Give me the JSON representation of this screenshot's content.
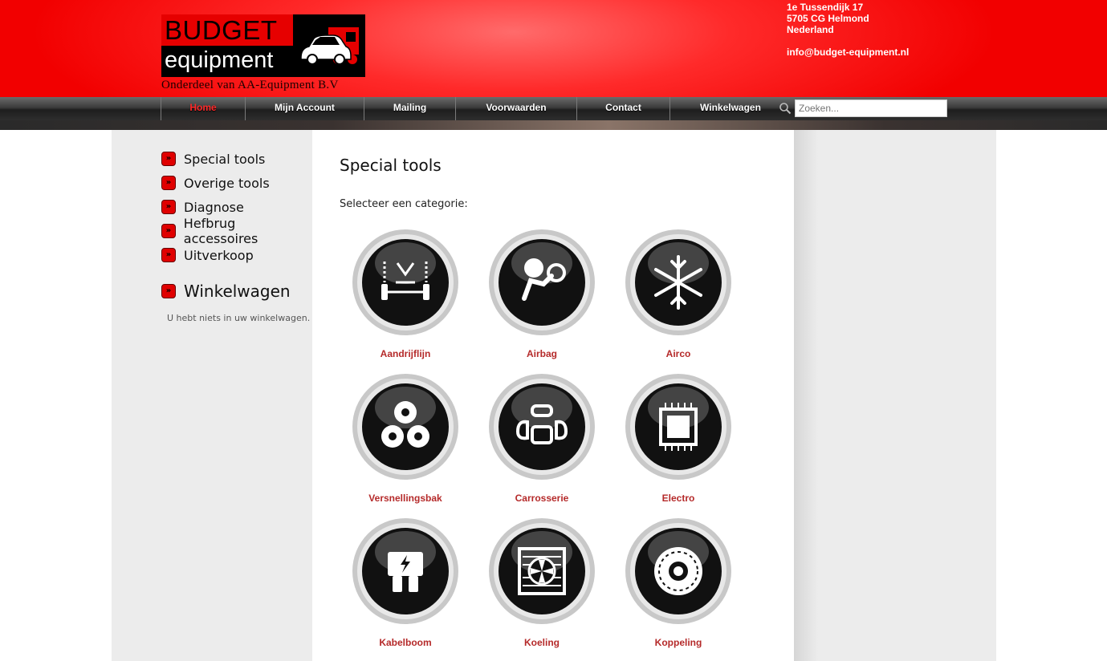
{
  "header": {
    "logo_word1": "BUDGET",
    "logo_word2": "equipment",
    "tagline": "Onderdeel van AA-Equipment B.V",
    "address": [
      "1e Tussendijk 17",
      "5705 CG Helmond",
      "Nederland"
    ],
    "email": "info@budget-equipment.nl"
  },
  "nav": {
    "items": [
      "Home",
      "Mijn Account",
      "Mailing",
      "Voorwaarden",
      "Contact",
      "Winkelwagen"
    ],
    "active": "Home",
    "search_placeholder": "Zoeken..."
  },
  "sidebar": {
    "items": [
      "Special tools",
      "Overige tools",
      "Diagnose",
      "Hefbrug accessoires",
      "Uitverkoop"
    ],
    "cart_title": "Winkelwagen",
    "cart_empty": "U hebt niets in uw winkelwagen."
  },
  "main": {
    "title": "Special tools",
    "select_label": "Selecteer een categorie:",
    "categories": [
      {
        "label": "Aandrijflijn",
        "icon": "axle-icon"
      },
      {
        "label": "Airbag",
        "icon": "airbag-icon"
      },
      {
        "label": "Airco",
        "icon": "snowflake-icon"
      },
      {
        "label": "Versnellingsbak",
        "icon": "gears-icon"
      },
      {
        "label": "Carrosserie",
        "icon": "car-body-icon"
      },
      {
        "label": "Electro",
        "icon": "chip-icon"
      },
      {
        "label": "Kabelboom",
        "icon": "fuse-icon"
      },
      {
        "label": "Koeling",
        "icon": "radiator-icon"
      },
      {
        "label": "Koppeling",
        "icon": "clutch-icon"
      }
    ]
  },
  "colors": {
    "header_red": "#f20000",
    "category_label": "#b52a2a",
    "nav_active": "#ff2a2a"
  }
}
